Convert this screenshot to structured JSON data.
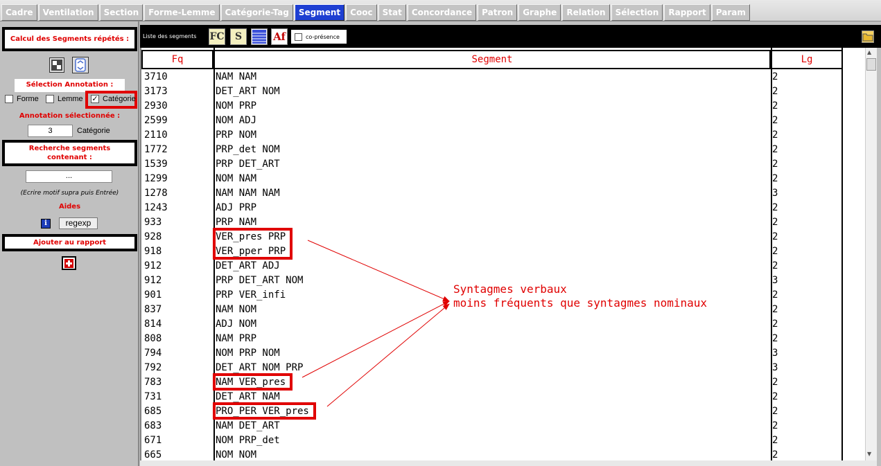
{
  "tabs": [
    {
      "label": "Cadre",
      "active": false
    },
    {
      "label": "Ventilation",
      "active": false
    },
    {
      "label": "Section",
      "active": false
    },
    {
      "label": "Forme-Lemme",
      "active": false
    },
    {
      "label": "Catégorie-Tag",
      "active": false
    },
    {
      "label": "Segment",
      "active": true
    },
    {
      "label": "Cooc",
      "active": false
    },
    {
      "label": "Stat",
      "active": false
    },
    {
      "label": "Concordance",
      "active": false
    },
    {
      "label": "Patron",
      "active": false
    },
    {
      "label": "Graphe",
      "active": false
    },
    {
      "label": "Relation",
      "active": false
    },
    {
      "label": "Sélection",
      "active": false
    },
    {
      "label": "Rapport",
      "active": false
    },
    {
      "label": "Param",
      "active": false
    }
  ],
  "left": {
    "calc_title": "Calcul des Segments répétés :",
    "selection_title": "Sélection Annotation :",
    "checkboxes": [
      {
        "label": "Forme",
        "checked": false
      },
      {
        "label": "Lemme",
        "checked": false
      },
      {
        "label": "Catégorie",
        "checked": true
      }
    ],
    "annot_selected_title": "Annotation sélectionnée :",
    "annot_value": "3",
    "annot_value_label": "Catégorie",
    "search_title": "Recherche segments contenant :",
    "search_value": "...",
    "search_hint": "(Ecrire motif supra puis Entrée)",
    "aides_title": "Aides",
    "regexp_label": "regexp",
    "rapport_title": "Ajouter au rapport"
  },
  "toolbar": {
    "list_label": "Liste des segments",
    "copresence_label": "co-présence",
    "copresence_checked": false
  },
  "table": {
    "headers": {
      "fq": "Fq",
      "segment": "Segment",
      "lg": "Lg"
    },
    "rows": [
      {
        "fq": "3710",
        "segment": "NAM NAM",
        "lg": "2"
      },
      {
        "fq": "3173",
        "segment": "DET_ART NOM",
        "lg": "2"
      },
      {
        "fq": "2930",
        "segment": "NOM PRP",
        "lg": "2"
      },
      {
        "fq": "2599",
        "segment": "NOM ADJ",
        "lg": "2"
      },
      {
        "fq": "2110",
        "segment": "PRP NOM",
        "lg": "2"
      },
      {
        "fq": "1772",
        "segment": "PRP_det NOM",
        "lg": "2"
      },
      {
        "fq": "1539",
        "segment": "PRP DET_ART",
        "lg": "2"
      },
      {
        "fq": "1299",
        "segment": "NOM NAM",
        "lg": "2"
      },
      {
        "fq": "1278",
        "segment": "NAM NAM NAM",
        "lg": "3"
      },
      {
        "fq": "1243",
        "segment": "ADJ PRP",
        "lg": "2"
      },
      {
        "fq": "933",
        "segment": "PRP NAM",
        "lg": "2"
      },
      {
        "fq": "928",
        "segment": "VER_pres PRP",
        "lg": "2"
      },
      {
        "fq": "918",
        "segment": "VER_pper PRP",
        "lg": "2"
      },
      {
        "fq": "912",
        "segment": "DET_ART ADJ",
        "lg": "2"
      },
      {
        "fq": "912",
        "segment": "PRP DET_ART NOM",
        "lg": "3"
      },
      {
        "fq": "901",
        "segment": "PRP VER_infi",
        "lg": "2"
      },
      {
        "fq": "837",
        "segment": "NAM NOM",
        "lg": "2"
      },
      {
        "fq": "814",
        "segment": "ADJ NOM",
        "lg": "2"
      },
      {
        "fq": "808",
        "segment": "NAM PRP",
        "lg": "2"
      },
      {
        "fq": "794",
        "segment": "NOM PRP NOM",
        "lg": "3"
      },
      {
        "fq": "792",
        "segment": "DET_ART NOM PRP",
        "lg": "3"
      },
      {
        "fq": "783",
        "segment": "NAM VER_pres",
        "lg": "2"
      },
      {
        "fq": "731",
        "segment": "DET_ART NAM",
        "lg": "2"
      },
      {
        "fq": "685",
        "segment": "PRO_PER VER_pres",
        "lg": "2"
      },
      {
        "fq": "683",
        "segment": "NAM DET_ART",
        "lg": "2"
      },
      {
        "fq": "671",
        "segment": "NOM PRP_det",
        "lg": "2"
      },
      {
        "fq": "665",
        "segment": "NOM NOM",
        "lg": "2"
      }
    ],
    "highlighted_rows": [
      11,
      12,
      21,
      23
    ]
  },
  "annotation": {
    "line1": "Syntagmes verbaux",
    "line2": "moins fréquents que syntagmes nominaux",
    "color": "#e00000"
  },
  "colors": {
    "active_tab": "#1e3fd2",
    "highlight": "#e00000",
    "panel_bg": "#c0c0c0"
  }
}
